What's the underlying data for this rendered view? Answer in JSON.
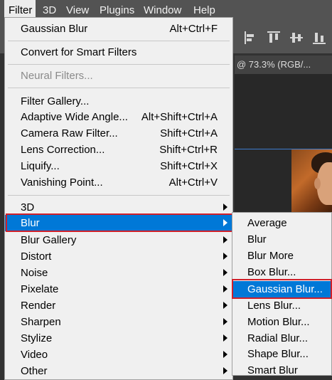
{
  "menubar": {
    "items": [
      "Filter",
      "3D",
      "View",
      "Plugins",
      "Window",
      "Help"
    ],
    "active": "Filter"
  },
  "document_tab": {
    "title": "@ 73.3% (RGB/..."
  },
  "filter_menu": {
    "last_filter": {
      "label": "Gaussian Blur",
      "shortcut": "Alt+Ctrl+F"
    },
    "convert_smart": {
      "label": "Convert for Smart Filters"
    },
    "neural_filters": {
      "label": "Neural Filters...",
      "disabled": true
    },
    "special_filters": [
      {
        "label": "Filter Gallery...",
        "shortcut": ""
      },
      {
        "label": "Adaptive Wide Angle...",
        "shortcut": "Alt+Shift+Ctrl+A"
      },
      {
        "label": "Camera Raw Filter...",
        "shortcut": "Shift+Ctrl+A"
      },
      {
        "label": "Lens Correction...",
        "shortcut": "Shift+Ctrl+R"
      },
      {
        "label": "Liquify...",
        "shortcut": "Shift+Ctrl+X"
      },
      {
        "label": "Vanishing Point...",
        "shortcut": "Alt+Ctrl+V"
      }
    ],
    "categories": [
      {
        "label": "3D",
        "highlighted": false
      },
      {
        "label": "Blur",
        "highlighted": true
      },
      {
        "label": "Blur Gallery",
        "highlighted": false
      },
      {
        "label": "Distort",
        "highlighted": false
      },
      {
        "label": "Noise",
        "highlighted": false
      },
      {
        "label": "Pixelate",
        "highlighted": false
      },
      {
        "label": "Render",
        "highlighted": false
      },
      {
        "label": "Sharpen",
        "highlighted": false
      },
      {
        "label": "Stylize",
        "highlighted": false
      },
      {
        "label": "Video",
        "highlighted": false
      },
      {
        "label": "Other",
        "highlighted": false
      }
    ]
  },
  "blur_submenu": {
    "items": [
      {
        "label": "Average",
        "highlighted": false
      },
      {
        "label": "Blur",
        "highlighted": false
      },
      {
        "label": "Blur More",
        "highlighted": false
      },
      {
        "label": "Box Blur...",
        "highlighted": false
      },
      {
        "label": "Gaussian Blur...",
        "highlighted": true
      },
      {
        "label": "Lens Blur...",
        "highlighted": false
      },
      {
        "label": "Motion Blur...",
        "highlighted": false
      },
      {
        "label": "Radial Blur...",
        "highlighted": false
      },
      {
        "label": "Shape Blur...",
        "highlighted": false
      },
      {
        "label": "Smart Blur",
        "highlighted": false
      }
    ]
  },
  "colors": {
    "highlight": "#0078d7",
    "annotation_box": "#d0202a",
    "menu_bg": "#f0f0f0",
    "app_chrome": "#535353"
  }
}
